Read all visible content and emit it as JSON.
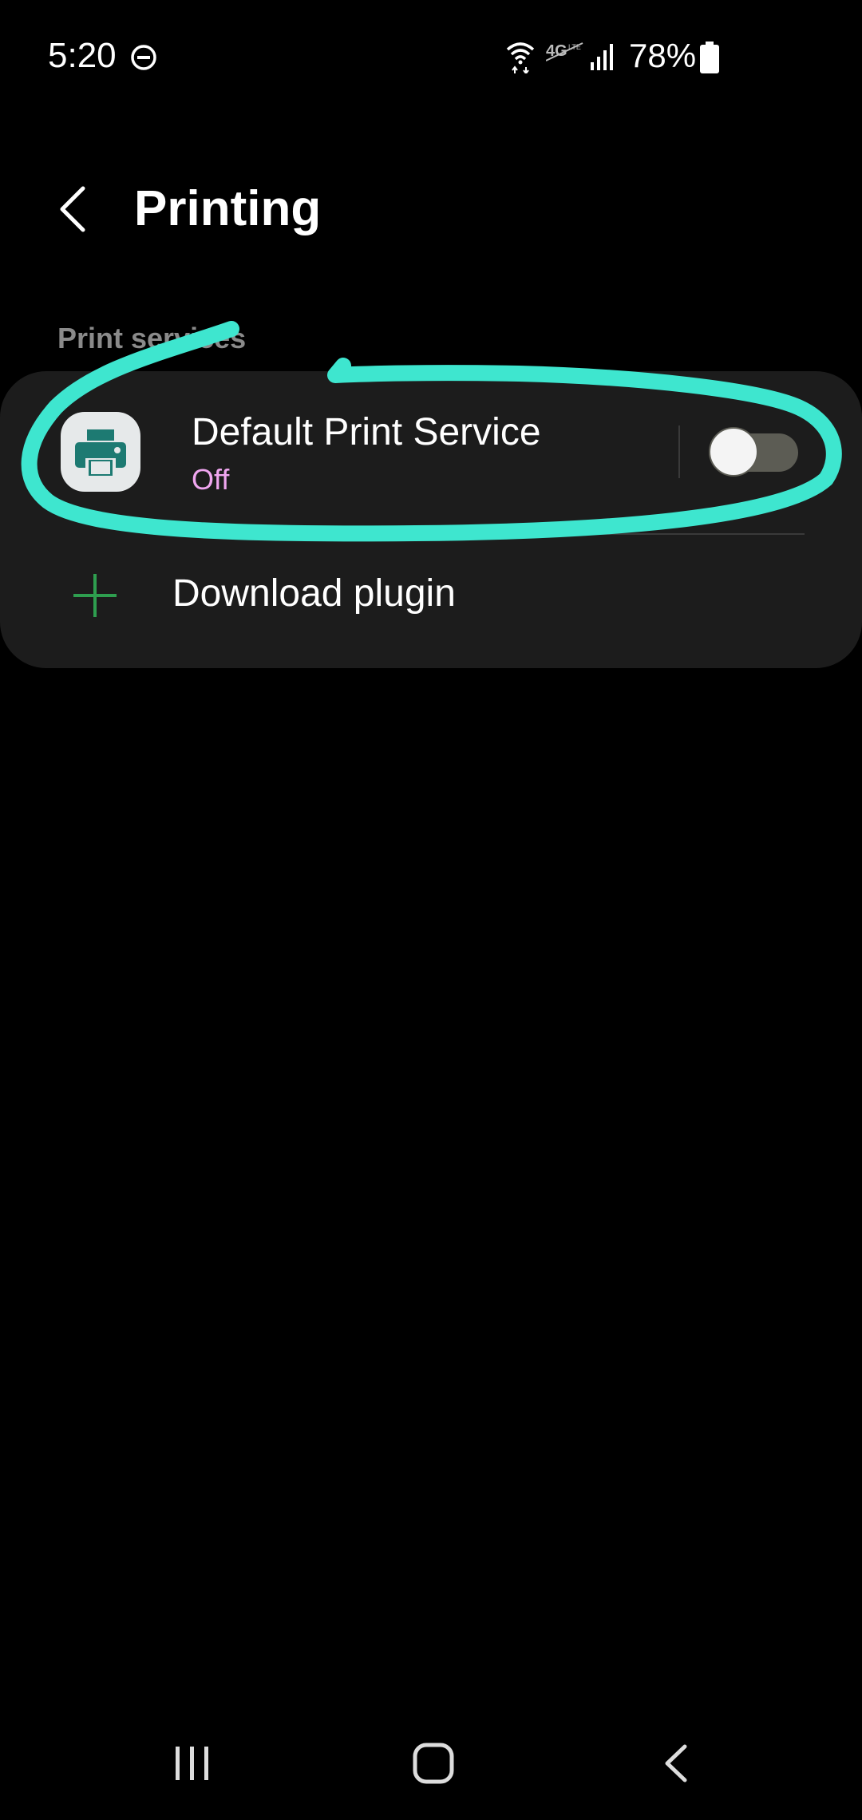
{
  "status_bar": {
    "time": "5:20",
    "battery_percent": "78%",
    "icons": [
      "do-not-disturb-icon",
      "wifi-icon",
      "lte-off-icon",
      "signal-icon",
      "battery-icon"
    ]
  },
  "header": {
    "title": "Printing",
    "back_icon": "chevron-left-icon"
  },
  "section": {
    "header": "Print services"
  },
  "services": [
    {
      "name": "Default Print Service",
      "status": "Off",
      "enabled": false,
      "icon": "printer-icon"
    }
  ],
  "download": {
    "label": "Download plugin",
    "icon": "plus-icon"
  },
  "nav_bar": {
    "icons": [
      "recents-icon",
      "home-icon",
      "back-icon"
    ]
  },
  "colors": {
    "background": "#000000",
    "card": "#1c1c1c",
    "status_off": "#f0a6f0",
    "plus_accent": "#2e9e4f",
    "printer_icon": "#1d7a72",
    "highlight": "#3ee6cf"
  }
}
